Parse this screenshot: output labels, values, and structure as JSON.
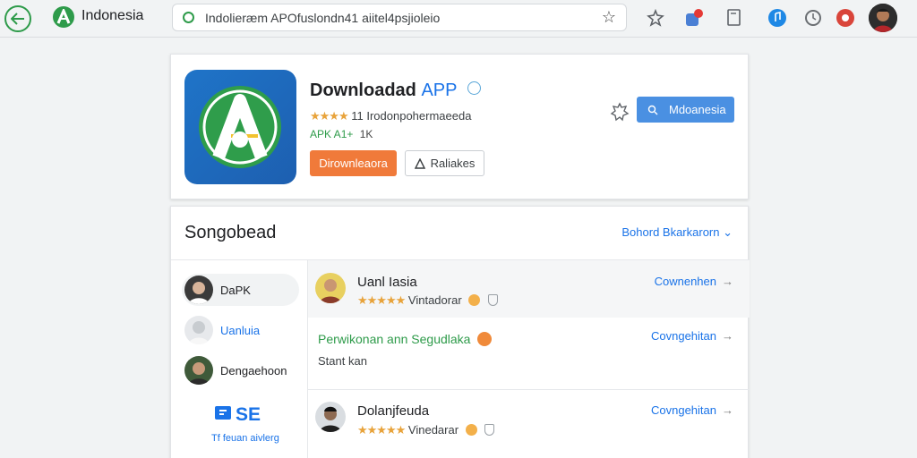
{
  "topbar": {
    "site_title": "Indonesia",
    "url": "Indolieræm APOfuslondn41 aiitel4psjioleio",
    "icons": [
      "back-icon",
      "app-logo",
      "lock-icon",
      "bookmark-star-icon",
      "puzzle-icon",
      "notification-icon",
      "document-icon",
      "music-icon",
      "history-icon",
      "record-icon",
      "profile-avatar"
    ]
  },
  "app": {
    "title": "Downloadad",
    "title_suffix": "APP",
    "stars": "★★★★",
    "rating_text": "11 Irodonpohermaeeda",
    "apk_label": "APK A1+",
    "apk_count": "1K",
    "download_label": "Dirownleaora",
    "related_label": "Raliakes",
    "region_label": "Mdoanesia"
  },
  "reviews": {
    "heading": "Songobead",
    "header_link": "Bohord Bkarkarorn ⌄",
    "sidebar": [
      {
        "label": "DaPK"
      },
      {
        "label": "Uanluia"
      },
      {
        "label": "Dengaehoon"
      }
    ],
    "sidebar_logo": "SE",
    "sidebar_footer": "Tf feuan aivlerg",
    "items": [
      {
        "name": "Uanl Iasia",
        "stars": "★★★★★",
        "meta": "Vintadorar",
        "action": "Cownenhen"
      },
      {
        "title": "Perwikonan ann Segudlaka",
        "body": "Stant kan",
        "action": "Covngehitan"
      },
      {
        "name": "Dolanjfeuda",
        "stars": "★★★★★",
        "meta": "Vinedarar",
        "action": "Covngehitan"
      }
    ]
  },
  "colors": {
    "accent_green": "#2e9b4a",
    "download_orange": "#f07a3a",
    "region_blue": "#4a90e2",
    "link_blue": "#1a73e8",
    "star_gold": "#e8a33b"
  }
}
